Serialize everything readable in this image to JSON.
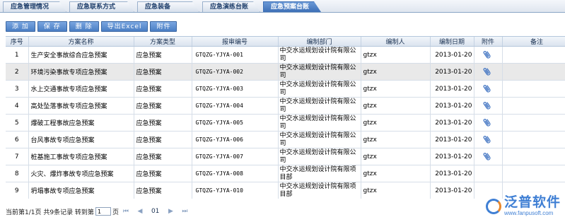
{
  "tabs": [
    {
      "label": "应急管理情况",
      "active": false
    },
    {
      "label": "应急联系方式",
      "active": false
    },
    {
      "label": "应急装备",
      "active": false
    },
    {
      "label": "应急演练台账",
      "active": false
    },
    {
      "label": "应急预案台账",
      "active": true
    }
  ],
  "toolbar": {
    "add_label": "添 加",
    "save_label": "保 存",
    "delete_label": "删 除",
    "export_label": "导出Excel",
    "attach_label": "附件"
  },
  "columns": {
    "index": "序号",
    "name": "方案名称",
    "type": "方案类型",
    "code": "报审编号",
    "dept": "编制部门",
    "author": "编制人",
    "date": "编制日期",
    "attachment": "附件",
    "remark": "备注"
  },
  "rows": [
    {
      "index": "1",
      "name": "生产安全事故综合应急预案",
      "type": "应急预案",
      "code": "GTQZG-YJYA-001",
      "dept": "中交水运规划设计院有限公司",
      "author": "gtzx",
      "date": "2013-01-20",
      "has_attachment": true,
      "remark": "",
      "selected": false
    },
    {
      "index": "2",
      "name": "环境污染事故专项应急预案",
      "type": "应急预案",
      "code": "GTQZG-YJYA-002",
      "dept": "中交水运规划设计院有限公司",
      "author": "gtzx",
      "date": "2013-01-20",
      "has_attachment": true,
      "remark": "",
      "selected": true
    },
    {
      "index": "3",
      "name": "水上交通事故专项应急预案",
      "type": "应急预案",
      "code": "GTQZG-YJYA-003",
      "dept": "中交水运规划设计院有限公司",
      "author": "gtzx",
      "date": "2013-01-20",
      "has_attachment": true,
      "remark": "",
      "selected": false
    },
    {
      "index": "4",
      "name": "高处坠落事故专项应急预案",
      "type": "应急预案",
      "code": "GTQZG-YJYA-004",
      "dept": "中交水运规划设计院有限公司",
      "author": "gtzx",
      "date": "2013-01-20",
      "has_attachment": true,
      "remark": "",
      "selected": false
    },
    {
      "index": "5",
      "name": "爆破工程事故应急预案",
      "type": "应急预案",
      "code": "GTQZG-YJYA-005",
      "dept": "中交水运规划设计院有限公司",
      "author": "gtzx",
      "date": "2013-01-20",
      "has_attachment": true,
      "remark": "",
      "selected": false
    },
    {
      "index": "6",
      "name": "台风事故专项应急预案",
      "type": "应急预案",
      "code": "GTQZG-YJYA-006",
      "dept": "中交水运规划设计院有限公司",
      "author": "gtzx",
      "date": "2013-01-20",
      "has_attachment": true,
      "remark": "",
      "selected": false
    },
    {
      "index": "7",
      "name": "桩基施工事故专项应急预案",
      "type": "应急预案",
      "code": "GTQZG-YJYA-007",
      "dept": "中交水运规划设计院有限公司",
      "author": "gtzx",
      "date": "2013-01-20",
      "has_attachment": true,
      "remark": "",
      "selected": false
    },
    {
      "index": "8",
      "name": "火灾、爆炸事故专项应急预案",
      "type": "应急预案",
      "code": "GTQZG-YJYA-008",
      "dept": "中交水运规划设计院有限项目部",
      "author": "gtzx",
      "date": "2013-01-20",
      "has_attachment": false,
      "remark": "",
      "selected": false
    },
    {
      "index": "9",
      "name": "坍塌事故专项应急预案",
      "type": "应急预案",
      "code": "GTQZG-YJYA-010",
      "dept": "中交水运规划设计院有限项目部",
      "author": "gtzx",
      "date": "2013-01-20",
      "has_attachment": false,
      "remark": "",
      "selected": false
    }
  ],
  "pager": {
    "summary": "当前第1/1页  共9条记录  转到第",
    "page_input": "1",
    "page_suffix": "页",
    "current_page": "01"
  },
  "watermark": {
    "name": "泛普软件",
    "url": "www.fanpusoft.com"
  },
  "colors": {
    "accent": "#3d6fb6",
    "selected_row": "#e9e9e9",
    "logo_blue": "#3f7fd4"
  }
}
